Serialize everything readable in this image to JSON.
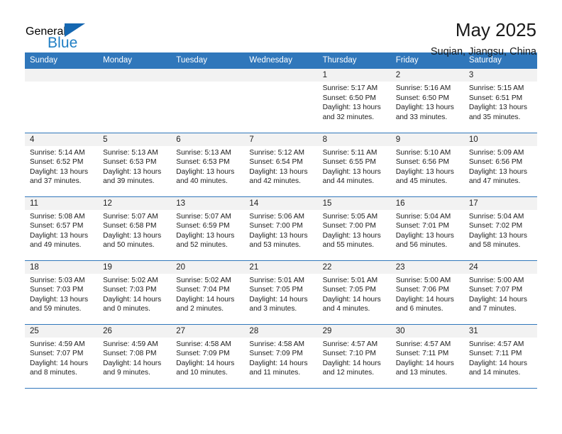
{
  "brand": {
    "name_part1": "General",
    "name_part2": "Blue",
    "flag_icon": "triangle-flag-icon"
  },
  "header": {
    "title": "May 2025",
    "subtitle": "Suqian, Jiangsu, China"
  },
  "colors": {
    "header_blue": "#3077bb",
    "brand_blue": "#1f7ec4",
    "daynum_strip": "#f2f2f2",
    "text": "#1c1c1c"
  },
  "calendar": {
    "weekday_headers": [
      "Sunday",
      "Monday",
      "Tuesday",
      "Wednesday",
      "Thursday",
      "Friday",
      "Saturday"
    ],
    "weeks": [
      [
        {
          "day": "",
          "empty": true,
          "sunrise": "",
          "sunset": "",
          "daylight_line1": "",
          "daylight_line2": ""
        },
        {
          "day": "",
          "empty": true,
          "sunrise": "",
          "sunset": "",
          "daylight_line1": "",
          "daylight_line2": ""
        },
        {
          "day": "",
          "empty": true,
          "sunrise": "",
          "sunset": "",
          "daylight_line1": "",
          "daylight_line2": ""
        },
        {
          "day": "",
          "empty": true,
          "sunrise": "",
          "sunset": "",
          "daylight_line1": "",
          "daylight_line2": ""
        },
        {
          "day": "1",
          "empty": false,
          "sunrise": "Sunrise: 5:17 AM",
          "sunset": "Sunset: 6:50 PM",
          "daylight_line1": "Daylight: 13 hours",
          "daylight_line2": "and 32 minutes."
        },
        {
          "day": "2",
          "empty": false,
          "sunrise": "Sunrise: 5:16 AM",
          "sunset": "Sunset: 6:50 PM",
          "daylight_line1": "Daylight: 13 hours",
          "daylight_line2": "and 33 minutes."
        },
        {
          "day": "3",
          "empty": false,
          "sunrise": "Sunrise: 5:15 AM",
          "sunset": "Sunset: 6:51 PM",
          "daylight_line1": "Daylight: 13 hours",
          "daylight_line2": "and 35 minutes."
        }
      ],
      [
        {
          "day": "4",
          "empty": false,
          "sunrise": "Sunrise: 5:14 AM",
          "sunset": "Sunset: 6:52 PM",
          "daylight_line1": "Daylight: 13 hours",
          "daylight_line2": "and 37 minutes."
        },
        {
          "day": "5",
          "empty": false,
          "sunrise": "Sunrise: 5:13 AM",
          "sunset": "Sunset: 6:53 PM",
          "daylight_line1": "Daylight: 13 hours",
          "daylight_line2": "and 39 minutes."
        },
        {
          "day": "6",
          "empty": false,
          "sunrise": "Sunrise: 5:13 AM",
          "sunset": "Sunset: 6:53 PM",
          "daylight_line1": "Daylight: 13 hours",
          "daylight_line2": "and 40 minutes."
        },
        {
          "day": "7",
          "empty": false,
          "sunrise": "Sunrise: 5:12 AM",
          "sunset": "Sunset: 6:54 PM",
          "daylight_line1": "Daylight: 13 hours",
          "daylight_line2": "and 42 minutes."
        },
        {
          "day": "8",
          "empty": false,
          "sunrise": "Sunrise: 5:11 AM",
          "sunset": "Sunset: 6:55 PM",
          "daylight_line1": "Daylight: 13 hours",
          "daylight_line2": "and 44 minutes."
        },
        {
          "day": "9",
          "empty": false,
          "sunrise": "Sunrise: 5:10 AM",
          "sunset": "Sunset: 6:56 PM",
          "daylight_line1": "Daylight: 13 hours",
          "daylight_line2": "and 45 minutes."
        },
        {
          "day": "10",
          "empty": false,
          "sunrise": "Sunrise: 5:09 AM",
          "sunset": "Sunset: 6:56 PM",
          "daylight_line1": "Daylight: 13 hours",
          "daylight_line2": "and 47 minutes."
        }
      ],
      [
        {
          "day": "11",
          "empty": false,
          "sunrise": "Sunrise: 5:08 AM",
          "sunset": "Sunset: 6:57 PM",
          "daylight_line1": "Daylight: 13 hours",
          "daylight_line2": "and 49 minutes."
        },
        {
          "day": "12",
          "empty": false,
          "sunrise": "Sunrise: 5:07 AM",
          "sunset": "Sunset: 6:58 PM",
          "daylight_line1": "Daylight: 13 hours",
          "daylight_line2": "and 50 minutes."
        },
        {
          "day": "13",
          "empty": false,
          "sunrise": "Sunrise: 5:07 AM",
          "sunset": "Sunset: 6:59 PM",
          "daylight_line1": "Daylight: 13 hours",
          "daylight_line2": "and 52 minutes."
        },
        {
          "day": "14",
          "empty": false,
          "sunrise": "Sunrise: 5:06 AM",
          "sunset": "Sunset: 7:00 PM",
          "daylight_line1": "Daylight: 13 hours",
          "daylight_line2": "and 53 minutes."
        },
        {
          "day": "15",
          "empty": false,
          "sunrise": "Sunrise: 5:05 AM",
          "sunset": "Sunset: 7:00 PM",
          "daylight_line1": "Daylight: 13 hours",
          "daylight_line2": "and 55 minutes."
        },
        {
          "day": "16",
          "empty": false,
          "sunrise": "Sunrise: 5:04 AM",
          "sunset": "Sunset: 7:01 PM",
          "daylight_line1": "Daylight: 13 hours",
          "daylight_line2": "and 56 minutes."
        },
        {
          "day": "17",
          "empty": false,
          "sunrise": "Sunrise: 5:04 AM",
          "sunset": "Sunset: 7:02 PM",
          "daylight_line1": "Daylight: 13 hours",
          "daylight_line2": "and 58 minutes."
        }
      ],
      [
        {
          "day": "18",
          "empty": false,
          "sunrise": "Sunrise: 5:03 AM",
          "sunset": "Sunset: 7:03 PM",
          "daylight_line1": "Daylight: 13 hours",
          "daylight_line2": "and 59 minutes."
        },
        {
          "day": "19",
          "empty": false,
          "sunrise": "Sunrise: 5:02 AM",
          "sunset": "Sunset: 7:03 PM",
          "daylight_line1": "Daylight: 14 hours",
          "daylight_line2": "and 0 minutes."
        },
        {
          "day": "20",
          "empty": false,
          "sunrise": "Sunrise: 5:02 AM",
          "sunset": "Sunset: 7:04 PM",
          "daylight_line1": "Daylight: 14 hours",
          "daylight_line2": "and 2 minutes."
        },
        {
          "day": "21",
          "empty": false,
          "sunrise": "Sunrise: 5:01 AM",
          "sunset": "Sunset: 7:05 PM",
          "daylight_line1": "Daylight: 14 hours",
          "daylight_line2": "and 3 minutes."
        },
        {
          "day": "22",
          "empty": false,
          "sunrise": "Sunrise: 5:01 AM",
          "sunset": "Sunset: 7:05 PM",
          "daylight_line1": "Daylight: 14 hours",
          "daylight_line2": "and 4 minutes."
        },
        {
          "day": "23",
          "empty": false,
          "sunrise": "Sunrise: 5:00 AM",
          "sunset": "Sunset: 7:06 PM",
          "daylight_line1": "Daylight: 14 hours",
          "daylight_line2": "and 6 minutes."
        },
        {
          "day": "24",
          "empty": false,
          "sunrise": "Sunrise: 5:00 AM",
          "sunset": "Sunset: 7:07 PM",
          "daylight_line1": "Daylight: 14 hours",
          "daylight_line2": "and 7 minutes."
        }
      ],
      [
        {
          "day": "25",
          "empty": false,
          "sunrise": "Sunrise: 4:59 AM",
          "sunset": "Sunset: 7:07 PM",
          "daylight_line1": "Daylight: 14 hours",
          "daylight_line2": "and 8 minutes."
        },
        {
          "day": "26",
          "empty": false,
          "sunrise": "Sunrise: 4:59 AM",
          "sunset": "Sunset: 7:08 PM",
          "daylight_line1": "Daylight: 14 hours",
          "daylight_line2": "and 9 minutes."
        },
        {
          "day": "27",
          "empty": false,
          "sunrise": "Sunrise: 4:58 AM",
          "sunset": "Sunset: 7:09 PM",
          "daylight_line1": "Daylight: 14 hours",
          "daylight_line2": "and 10 minutes."
        },
        {
          "day": "28",
          "empty": false,
          "sunrise": "Sunrise: 4:58 AM",
          "sunset": "Sunset: 7:09 PM",
          "daylight_line1": "Daylight: 14 hours",
          "daylight_line2": "and 11 minutes."
        },
        {
          "day": "29",
          "empty": false,
          "sunrise": "Sunrise: 4:57 AM",
          "sunset": "Sunset: 7:10 PM",
          "daylight_line1": "Daylight: 14 hours",
          "daylight_line2": "and 12 minutes."
        },
        {
          "day": "30",
          "empty": false,
          "sunrise": "Sunrise: 4:57 AM",
          "sunset": "Sunset: 7:11 PM",
          "daylight_line1": "Daylight: 14 hours",
          "daylight_line2": "and 13 minutes."
        },
        {
          "day": "31",
          "empty": false,
          "sunrise": "Sunrise: 4:57 AM",
          "sunset": "Sunset: 7:11 PM",
          "daylight_line1": "Daylight: 14 hours",
          "daylight_line2": "and 14 minutes."
        }
      ]
    ]
  }
}
